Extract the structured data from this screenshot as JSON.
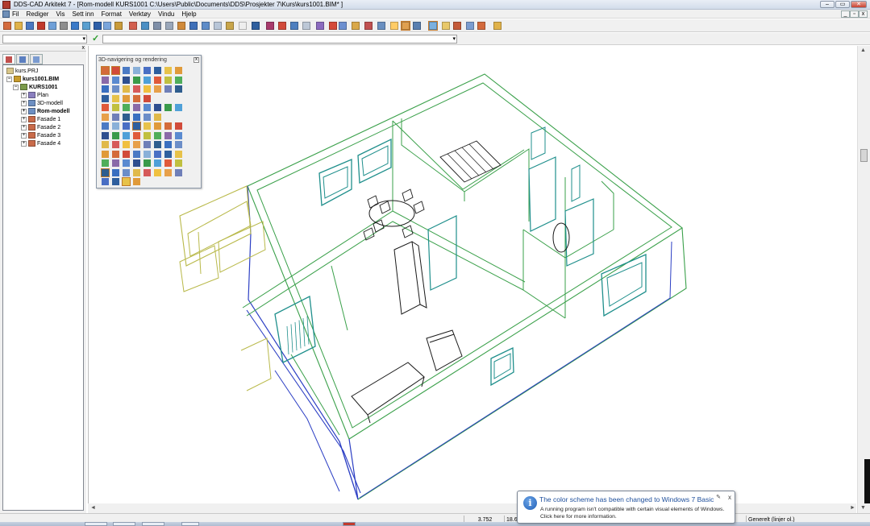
{
  "window": {
    "title": "DDS-CAD Arkitekt 7 - [Rom-modell  KURS1001  C:\\Users\\Public\\Documents\\DDS\\Prosjekter 7\\Kurs\\kurs1001.BIM* ]",
    "minimize": "–",
    "restore": "▭",
    "close": "✕"
  },
  "menubar": {
    "items": [
      "Fil",
      "Rediger",
      "Vis",
      "Sett inn",
      "Format",
      "Verktøy",
      "Vindu",
      "Hjelp"
    ],
    "mdi_controls": [
      "_",
      "▫",
      "x"
    ]
  },
  "commandrow": {
    "combo1_value": "",
    "combo2_value": "",
    "dropdown_arrow": "▾",
    "apply_glyph": "✓"
  },
  "tree": {
    "panel_close": "x",
    "nodes": [
      {
        "label": "kurs.PRJ",
        "expander": "",
        "bold": false,
        "color": "#d8c68a"
      },
      {
        "label": "kurs1001.BIM",
        "expander": "−",
        "bold": true,
        "color": "#c79b2c"
      },
      {
        "label": "KURS1001",
        "expander": "−",
        "bold": true,
        "color": "#7a9a4a"
      },
      {
        "label": "Plan",
        "expander": "+",
        "bold": false,
        "color": "#8a7fbf"
      },
      {
        "label": "3D-modell",
        "expander": "+",
        "bold": false,
        "color": "#6d8fc2"
      },
      {
        "label": "Rom-modell",
        "expander": "+",
        "bold": true,
        "color": "#6d8fc2"
      },
      {
        "label": "Fasade 1",
        "expander": "+",
        "bold": false,
        "color": "#c96b4a"
      },
      {
        "label": "Fasade 2",
        "expander": "+",
        "bold": false,
        "color": "#c96b4a"
      },
      {
        "label": "Fasade 3",
        "expander": "+",
        "bold": false,
        "color": "#c96b4a"
      },
      {
        "label": "Fasade 4",
        "expander": "+",
        "bold": false,
        "color": "#c96b4a"
      }
    ]
  },
  "palette": {
    "title": "3D-navigering og rendering",
    "close": "x"
  },
  "scroll": {
    "up": "▲",
    "down": "▼",
    "left": "◄",
    "right": "►"
  },
  "statusbar": {
    "coord_x": "3.752",
    "coord_y": "18.65",
    "layer": "Generelt (linjer ol.)"
  },
  "notification": {
    "title": "The color scheme has been changed to Windows 7 Basic",
    "body_line1": "A running program isn't compatible with certain visual elements of Windows.",
    "body_line2": "Click here for more information.",
    "close": "x",
    "options": "✎"
  },
  "colors": {
    "wall_green": "#3aa04a",
    "outline_blue": "#2c3fc4",
    "window_teal": "#1f8f8c",
    "balcony_olive": "#b9b94a",
    "furniture_black": "#1a1a1a"
  }
}
